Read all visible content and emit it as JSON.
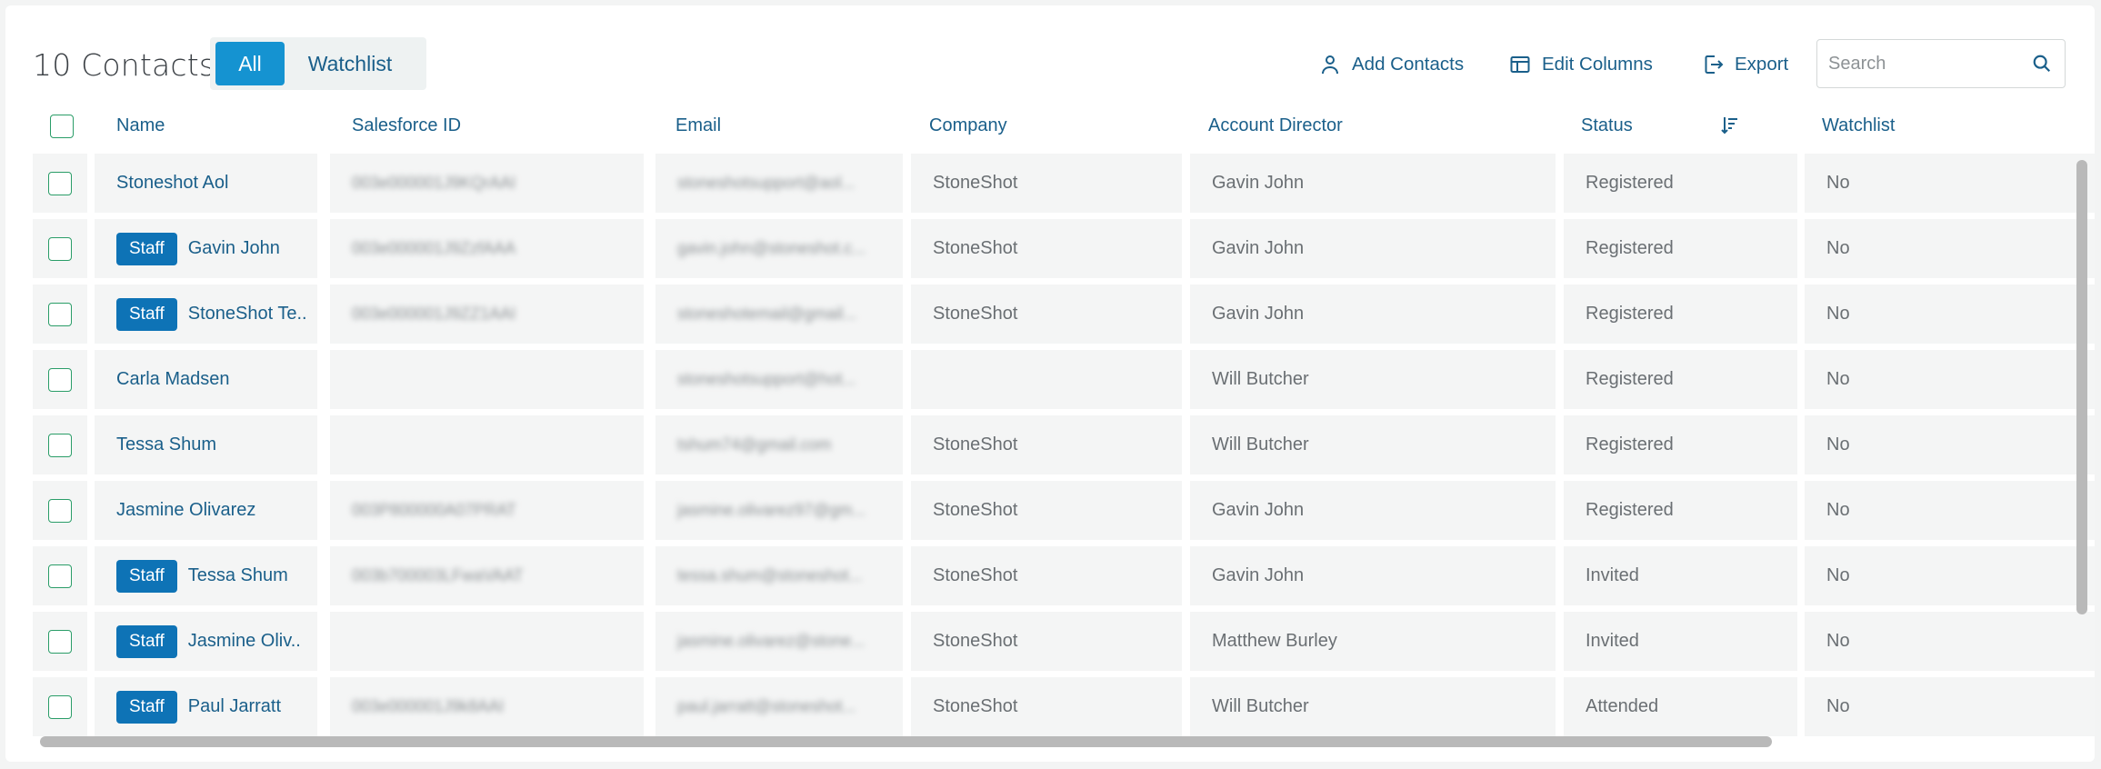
{
  "header": {
    "count_title": "10 Contacts",
    "filter_all": "All",
    "filter_watchlist": "Watchlist",
    "add_contacts": "Add Contacts",
    "edit_columns": "Edit Columns",
    "export": "Export",
    "search_placeholder": "Search"
  },
  "columns": {
    "name": "Name",
    "salesforce_id": "Salesforce ID",
    "email": "Email",
    "company": "Company",
    "account_director": "Account Director",
    "status": "Status",
    "watchlist": "Watchlist"
  },
  "staff_label": "Staff",
  "rows": [
    {
      "staff": false,
      "name": "Stoneshot Aol",
      "sfid": "003e000001J9KQrAAI",
      "email": "stoneshotsupport@aol...",
      "company": "StoneShot",
      "director": "Gavin John",
      "status": "Registered",
      "watchlist": "No"
    },
    {
      "staff": true,
      "name": "Gavin John",
      "sfid": "003e000001J9ZzfAAA",
      "email": "gavin.john@stoneshot.c...",
      "company": "StoneShot",
      "director": "Gavin John",
      "status": "Registered",
      "watchlist": "No"
    },
    {
      "staff": true,
      "name": "StoneShot Te..",
      "sfid": "003e000001J9ZZ1AAI",
      "email": "stoneshotemail@gmail...",
      "company": "StoneShot",
      "director": "Gavin John",
      "status": "Registered",
      "watchlist": "No"
    },
    {
      "staff": false,
      "name": "Carla Madsen",
      "sfid": "",
      "email": "stoneshotsupport@hot...",
      "company": "",
      "director": "Will Butcher",
      "status": "Registered",
      "watchlist": "No"
    },
    {
      "staff": false,
      "name": "Tessa Shum",
      "sfid": "",
      "email": "tshum74@gmail.com",
      "company": "StoneShot",
      "director": "Will Butcher",
      "status": "Registered",
      "watchlist": "No"
    },
    {
      "staff": false,
      "name": "Jasmine Olivarez",
      "sfid": "003P800000A07PRAT",
      "email": "jasmine.olivarez97@gm...",
      "company": "StoneShot",
      "director": "Gavin John",
      "status": "Registered",
      "watchlist": "No"
    },
    {
      "staff": true,
      "name": "Tessa Shum",
      "sfid": "003b700003LFwaVAAT",
      "email": "tessa.shum@stoneshot...",
      "company": "StoneShot",
      "director": "Gavin John",
      "status": "Invited",
      "watchlist": "No"
    },
    {
      "staff": true,
      "name": "Jasmine Oliv..",
      "sfid": "",
      "email": "jasmine.olivarez@stone...",
      "company": "StoneShot",
      "director": "Matthew Burley",
      "status": "Invited",
      "watchlist": "No"
    },
    {
      "staff": true,
      "name": "Paul Jarratt",
      "sfid": "003e000001J9k8AAI",
      "email": "paul.jarratt@stoneshot...",
      "company": "StoneShot",
      "director": "Will Butcher",
      "status": "Attended",
      "watchlist": "No"
    }
  ],
  "colors": {
    "accent": "#1593d1",
    "link": "#1a5f8a",
    "staff_badge": "#0e73b6",
    "checkbox_border": "#2a9d68"
  },
  "icons": {
    "add_contacts": "person-icon",
    "edit_columns": "columns-icon",
    "export": "export-icon",
    "search": "search-icon",
    "sort": "sort-descending-icon"
  }
}
